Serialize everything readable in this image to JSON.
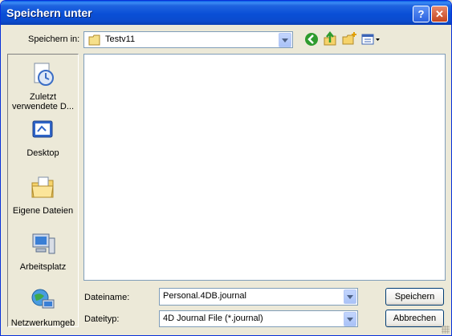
{
  "window": {
    "title": "Speichern unter",
    "help_glyph": "?",
    "close_glyph": "✕"
  },
  "location": {
    "label": "Speichern in:",
    "value": "Testv11"
  },
  "places": [
    {
      "label": "Zuletzt verwendete D...",
      "icon": "recent-documents-icon"
    },
    {
      "label": "Desktop",
      "icon": "desktop-icon"
    },
    {
      "label": "Eigene Dateien",
      "icon": "my-documents-icon"
    },
    {
      "label": "Arbeitsplatz",
      "icon": "my-computer-icon"
    },
    {
      "label": "Netzwerkumgeb",
      "icon": "network-places-icon"
    }
  ],
  "filename": {
    "label": "Dateiname:",
    "value": "Personal.4DB.journal"
  },
  "filetype": {
    "label": "Dateityp:",
    "value": "4D Journal File (*.journal)"
  },
  "buttons": {
    "save": "Speichern",
    "cancel": "Abbrechen"
  },
  "colors": {
    "titlebar": "#0a4fd6",
    "dialog_bg": "#ece9d8",
    "accent_green": "#2e9b2e"
  }
}
